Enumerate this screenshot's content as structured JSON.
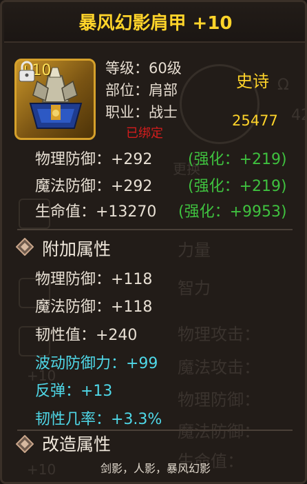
{
  "item": {
    "title": "暴风幻影肩甲 +10",
    "enhance_badge": "+10",
    "rarity": "史诗",
    "score": "25477",
    "bound": "已绑定",
    "info": [
      {
        "text": "等级：60级"
      },
      {
        "text": "部位：肩部"
      },
      {
        "text": "职业：战士"
      }
    ]
  },
  "base_stats": [
    {
      "label": "物理防御：+292",
      "bonus": "(强化：+219)"
    },
    {
      "label": "魔法防御：+292",
      "bonus": "(强化：+219)"
    },
    {
      "label": "生命值：+13270",
      "bonus": "(强化：+9953)"
    }
  ],
  "bonus_section": {
    "title": "附加属性",
    "white_stats": [
      "物理防御：+118",
      "魔法防御：+118",
      "韧性值：+240"
    ],
    "cyan_stats": [
      "波动防御力：+99",
      "反弹：+13",
      "韧性几率：+3.3%"
    ]
  },
  "reforge_section": {
    "title": "改造属性",
    "text": "剑影，人影，暴风幻影"
  },
  "background_ghost": {
    "labels": [
      "力量",
      "智力",
      "物理攻击：",
      "魔法攻击：",
      "物理防御：",
      "魔法防御：",
      "生命值：",
      "更换",
      "+10",
      "+10",
      "42",
      "Ω"
    ]
  },
  "colors": {
    "title_gold": "#ffd42a",
    "bonus_green": "#3fc13f",
    "special_cyan": "#4fd8e8",
    "bound_red": "#d51d1d"
  }
}
